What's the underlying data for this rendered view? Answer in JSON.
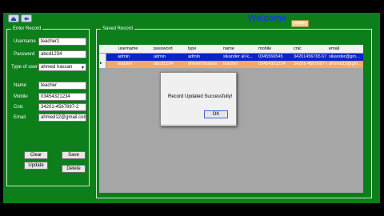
{
  "header": {
    "welcome": "Welcome",
    "user_badge": "admin",
    "nav_back_icon": "home-icon",
    "nav_fwd_icon": "back-arrow-icon"
  },
  "enter_record": {
    "title": "Enter Record",
    "username_label": "Username",
    "username_value": "teacher1",
    "password_label": "Password",
    "password_value": "abcd1234",
    "type_label": "Type of user",
    "type_value": "ahmed hassan",
    "name_label": "Name",
    "name_value": "teacher",
    "mobile_label": "Mobile",
    "mobile_value": "03454321234",
    "cnic_label": "Cnic",
    "cnic_value": "34201-4567897-2",
    "email_label": "Email",
    "email_value": "ahmed12@gmail.com",
    "buttons": {
      "clear": "Clear",
      "save": "Save",
      "update": "Update",
      "delete": "Delete"
    }
  },
  "saved_record": {
    "title": "Saved Record",
    "columns": [
      "username",
      "password",
      "type",
      "name",
      "mobile",
      "cnic",
      "email"
    ],
    "rows": [
      [
        "admin",
        "admin",
        "admin",
        "sikander ali k...",
        "0345566545",
        "34201456765 67",
        "sikander@gm..."
      ],
      [
        "teacher",
        "abcd1234",
        "ahmed hassan",
        "teacher",
        "03454321234",
        "34201-4567897-2",
        "ahmed12@gm..."
      ]
    ]
  },
  "dialog": {
    "message": "Record Updated Successfully!",
    "ok": "OK"
  }
}
